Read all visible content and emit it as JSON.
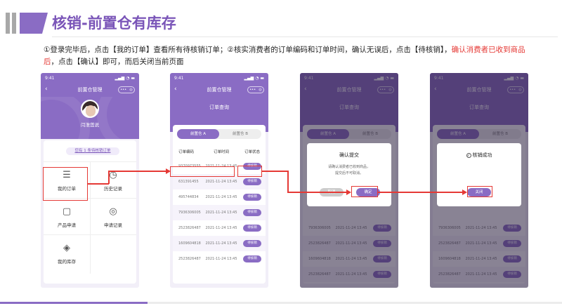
{
  "header": {
    "title": "核销-前置仓有库存",
    "description_a": "①登录完毕后，点击【我的订单】查看所有待核销订单；②核实消费者的订单编码和订单时间，确认无误后，点击【待核销】，",
    "description_red": "确认消费者已收到商品后",
    "description_b": "，点击【确认】即可，而后关闭当前页面"
  },
  "phone": {
    "time": "9:41",
    "signal": "▂▄▆ ◔ ▬",
    "nav_title": "前置仓管理"
  },
  "screen1": {
    "user_name": "闫淮莲说",
    "notice": "您有 1 条待核销订单",
    "grid": [
      {
        "label": "我的订单",
        "icon": "list-icon"
      },
      {
        "label": "历史记录",
        "icon": "history-icon"
      },
      {
        "label": "产品申请",
        "icon": "bag-icon"
      },
      {
        "label": "申请记录",
        "icon": "record-icon"
      },
      {
        "label": "我的库存",
        "icon": "layers-icon"
      }
    ]
  },
  "screen2": {
    "subtitle": "订单查询",
    "tab_a": "前置仓 A",
    "tab_b": "前置仓 B",
    "col_code": "订单编码",
    "col_time": "订单时间",
    "col_status": "订单状态",
    "rows": [
      {
        "code": "9370973555",
        "time": "2021-11-24 13:45",
        "action": "待核销"
      },
      {
        "code": "631391455",
        "time": "2021-11-24 13:45",
        "action": "待核销"
      },
      {
        "code": "495744834",
        "time": "2021-11-24 13:45",
        "action": "待核销"
      },
      {
        "code": "7936306005",
        "time": "2021-11-24 13:45",
        "action": "待核销"
      },
      {
        "code": "2523826487",
        "time": "2021-11-24 13:45",
        "action": "待核销"
      },
      {
        "code": "1609604818",
        "time": "2021-11-24 13:45",
        "action": "待核销"
      },
      {
        "code": "2523826487",
        "time": "2021-11-24 13:45",
        "action": "待核销"
      }
    ]
  },
  "screen3": {
    "modal_title": "确认提交",
    "modal_line1": "请确认消费者已收到商品，",
    "modal_line2": "提交后不可取消。",
    "cancel": "取消",
    "confirm": "确定"
  },
  "screen4": {
    "modal_title": "核销成功",
    "close": "关闭"
  },
  "colors": {
    "accent": "#8a6cc4",
    "highlight": "#e53935"
  }
}
